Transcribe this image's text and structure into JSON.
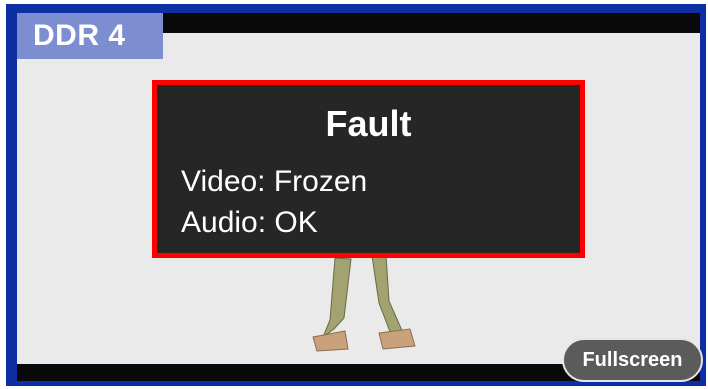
{
  "channel": {
    "label": "DDR 4"
  },
  "fault": {
    "title": "Fault",
    "video_status": "Video: Frozen",
    "audio_status": "Audio: OK"
  },
  "controls": {
    "fullscreen_label": "Fullscreen"
  },
  "colors": {
    "frame": "#0e2ea3",
    "label_background": "#7d8ed0",
    "fault_border": "#ff0000",
    "fault_background": "#262626"
  }
}
